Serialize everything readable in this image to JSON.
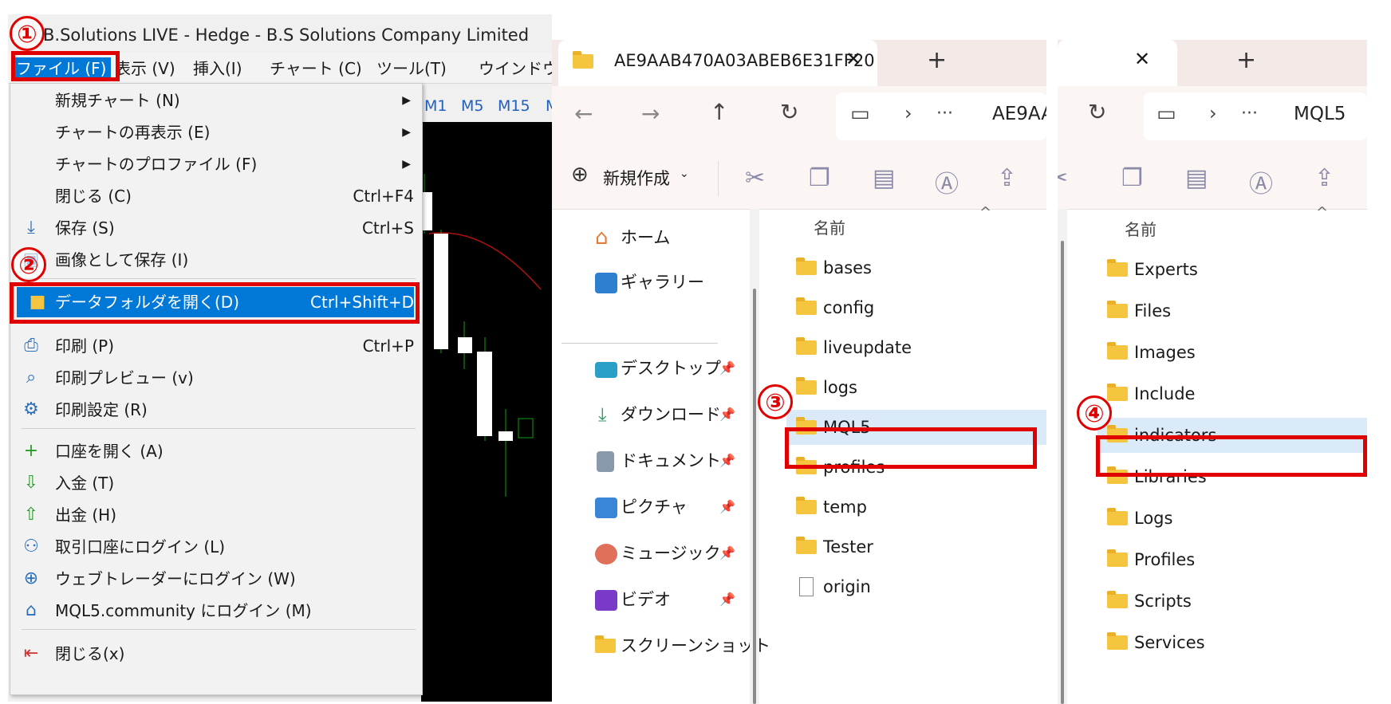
{
  "mt5": {
    "title": "B.Solutions LIVE - Hedge - B.S Solutions Company Limited",
    "menubar": [
      "ファイル (F)",
      "表示 (V)",
      "挿入(I)",
      "チャート (C)",
      "ツール(T)",
      "ウインドウ(W"
    ],
    "timeframes": [
      "M1",
      "M5",
      "M15",
      "M"
    ],
    "file_menu": [
      {
        "label": "新規チャート (N)",
        "shortcut": "",
        "submenu": true,
        "icon": ""
      },
      {
        "label": "チャートの再表示 (E)",
        "shortcut": "",
        "submenu": true,
        "icon": ""
      },
      {
        "label": "チャートのプロファイル (F)",
        "shortcut": "",
        "submenu": true,
        "icon": ""
      },
      {
        "label": "閉じる (C)",
        "shortcut": "Ctrl+F4",
        "submenu": false,
        "icon": ""
      },
      {
        "label": "保存 (S)",
        "shortcut": "Ctrl+S",
        "submenu": false,
        "icon": "save-icon"
      },
      {
        "label": "画像として保存 (I)",
        "shortcut": "",
        "submenu": false,
        "icon": "image-icon"
      },
      {
        "label": "データフォルダを開く(D)",
        "shortcut": "Ctrl+Shift+D",
        "submenu": false,
        "icon": "folder-icon"
      },
      {
        "label": "印刷 (P)",
        "shortcut": "Ctrl+P",
        "submenu": false,
        "icon": "printer-icon"
      },
      {
        "label": "印刷プレビュー (v)",
        "shortcut": "",
        "submenu": false,
        "icon": "print-preview-icon"
      },
      {
        "label": "印刷設定 (R)",
        "shortcut": "",
        "submenu": false,
        "icon": "print-settings-icon"
      },
      {
        "label": "口座を開く (A)",
        "shortcut": "",
        "submenu": false,
        "icon": "plus-icon"
      },
      {
        "label": "入金 (T)",
        "shortcut": "",
        "submenu": false,
        "icon": "deposit-icon"
      },
      {
        "label": "出金 (H)",
        "shortcut": "",
        "submenu": false,
        "icon": "withdraw-icon"
      },
      {
        "label": "取引口座にログイン (L)",
        "shortcut": "",
        "submenu": false,
        "icon": "user-icon"
      },
      {
        "label": "ウェブトレーダーにログイン (W)",
        "shortcut": "",
        "submenu": false,
        "icon": "globe-icon"
      },
      {
        "label": "MQL5.community にログイン (M)",
        "shortcut": "",
        "submenu": false,
        "icon": "graduation-cap-icon"
      },
      {
        "label": "閉じる(x)",
        "shortcut": "",
        "submenu": false,
        "icon": "exit-icon"
      }
    ]
  },
  "markers": [
    "①",
    "②",
    "③",
    "④"
  ],
  "explorer1": {
    "tab_title": "AE9AAB470A03ABEB6E31FF20",
    "tab_close": "✕",
    "new_tab": "+",
    "path": "AE9AA",
    "more": "···",
    "new_button": "新規作成",
    "column_header": "名前",
    "nav_items": [
      {
        "label": "ホーム",
        "icon": "home-icon",
        "pinned": false
      },
      {
        "label": "ギャラリー",
        "icon": "gallery-icon",
        "pinned": false
      },
      {
        "label": "デスクトップ",
        "icon": "desktop-icon",
        "pinned": true
      },
      {
        "label": "ダウンロード",
        "icon": "download-icon",
        "pinned": true
      },
      {
        "label": "ドキュメント",
        "icon": "document-icon",
        "pinned": true
      },
      {
        "label": "ピクチャ",
        "icon": "pictures-icon",
        "pinned": true
      },
      {
        "label": "ミュージック",
        "icon": "music-icon",
        "pinned": true
      },
      {
        "label": "ビデオ",
        "icon": "video-icon",
        "pinned": true
      },
      {
        "label": "スクリーンショット",
        "icon": "folder-icon",
        "pinned": false
      }
    ],
    "files": [
      {
        "name": "bases",
        "type": "folder"
      },
      {
        "name": "config",
        "type": "folder"
      },
      {
        "name": "liveupdate",
        "type": "folder"
      },
      {
        "name": "logs",
        "type": "folder"
      },
      {
        "name": "MQL5",
        "type": "folder",
        "selected": true
      },
      {
        "name": "profiles",
        "type": "folder"
      },
      {
        "name": "temp",
        "type": "folder"
      },
      {
        "name": "Tester",
        "type": "folder"
      },
      {
        "name": "origin",
        "type": "file"
      }
    ]
  },
  "explorer2": {
    "tab_close": "✕",
    "new_tab": "+",
    "path": "MQL5",
    "more": "···",
    "column_header": "名前",
    "files": [
      {
        "name": "Experts"
      },
      {
        "name": "Files"
      },
      {
        "name": "Images"
      },
      {
        "name": "Include"
      },
      {
        "name": "indicators",
        "selected": true
      },
      {
        "name": "Libraries"
      },
      {
        "name": "Logs"
      },
      {
        "name": "Profiles"
      },
      {
        "name": "Scripts"
      },
      {
        "name": "Services"
      }
    ]
  }
}
